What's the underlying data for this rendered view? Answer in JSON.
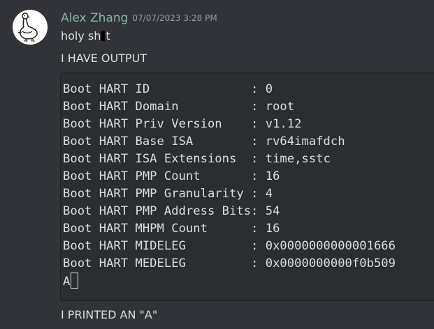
{
  "message": {
    "author": "Alex Zhang",
    "timestamp": "07/07/2023 3:28 PM",
    "line1_before": "holy sh",
    "line1_after": "t",
    "line2": "I HAVE OUTPUT",
    "line3": "I PRINTED AN \"A\""
  },
  "code_block": {
    "lines": [
      "Boot HART ID              : 0",
      "Boot HART Domain          : root",
      "Boot HART Priv Version    : v1.12",
      "Boot HART Base ISA        : rv64imafdch",
      "Boot HART ISA Extensions  : time,sstc",
      "Boot HART PMP Count       : 16",
      "Boot HART PMP Granularity : 4",
      "Boot HART PMP Address Bits: 54",
      "Boot HART MHPM Count      : 16",
      "Boot HART MIDELEG         : 0x0000000000001666",
      "Boot HART MEDELEG         : 0x0000000000f0b509"
    ],
    "last_line": "A"
  },
  "colors": {
    "background": "#313338",
    "username": "#7fb8ab",
    "code_background": "#2b2d31"
  },
  "icons": {
    "avatar": "goose-avatar"
  }
}
